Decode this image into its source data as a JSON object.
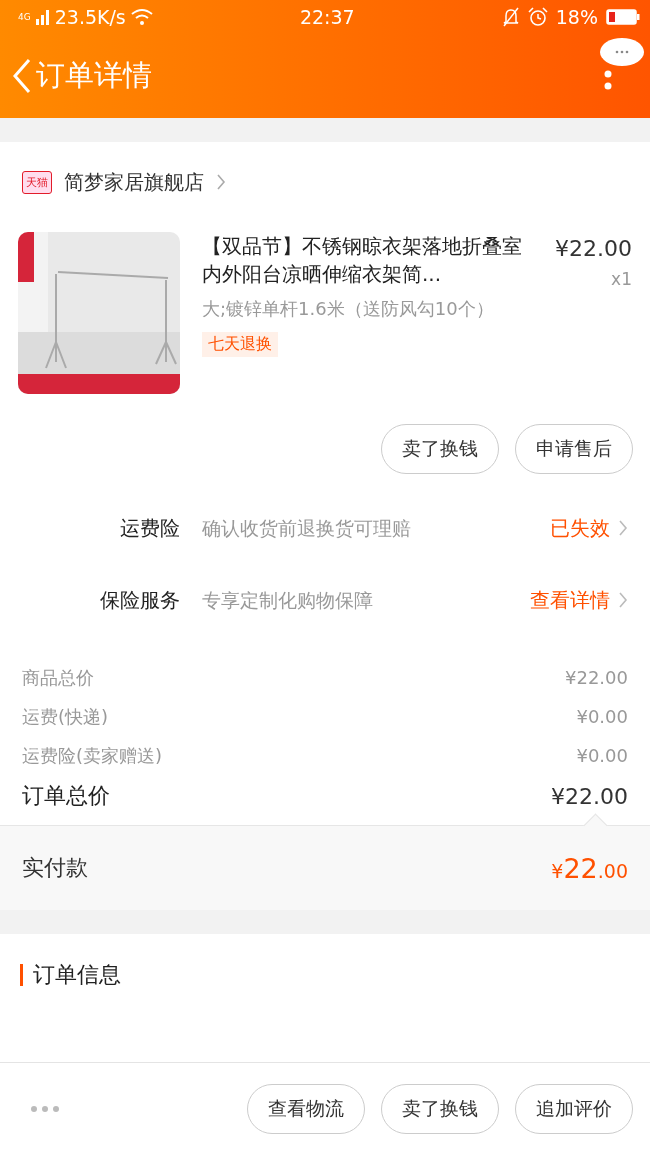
{
  "status_bar": {
    "network": "4G",
    "speed": "23.5K/s",
    "time": "22:37",
    "battery_text": "18%"
  },
  "header": {
    "title": "订单详情"
  },
  "store": {
    "badge": "天猫",
    "name": "简梦家居旗舰店"
  },
  "product": {
    "title": "【双品节】不锈钢晾衣架落地折叠室内外阳台凉晒伸缩衣架简...",
    "price": "¥22.00",
    "quantity": "x1",
    "sku": "大;镀锌单杆1.6米（送防风勾10个）",
    "tag": "七天退换"
  },
  "item_buttons": [
    "卖了换钱",
    "申请售后"
  ],
  "services": [
    {
      "label": "运费险",
      "description": "确认收货前退换货可理赔",
      "action": "已失效"
    },
    {
      "label": "保险服务",
      "description": "专享定制化购物保障",
      "action": "查看详情"
    }
  ],
  "prices": [
    {
      "label": "商品总价",
      "value": "¥22.00"
    },
    {
      "label": "运费(快递)",
      "value": "¥0.00"
    },
    {
      "label": "运费险(卖家赠送)",
      "value": "¥0.00"
    }
  ],
  "order_total": {
    "label": "订单总价",
    "value": "¥22.00"
  },
  "paid": {
    "label": "实付款",
    "currency": "¥",
    "integer": "22",
    "decimals": ".00"
  },
  "order_info": {
    "title": "订单信息"
  },
  "bottom_bar": {
    "buttons": [
      "查看物流",
      "卖了换钱",
      "追加评价"
    ]
  }
}
